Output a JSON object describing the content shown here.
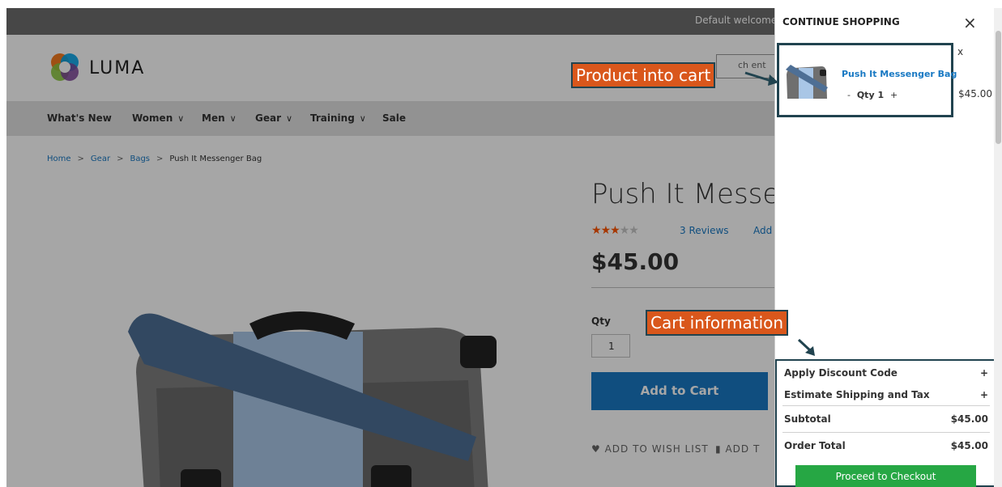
{
  "topbar": {
    "welcome": "Default welcome"
  },
  "header": {
    "logo_text": "LUMA",
    "search_placeholder": "ch ent"
  },
  "nav": [
    {
      "label": "What's New",
      "chevron": ""
    },
    {
      "label": "Women",
      "chevron": "∨"
    },
    {
      "label": "Men",
      "chevron": "∨"
    },
    {
      "label": "Gear",
      "chevron": "∨"
    },
    {
      "label": "Training",
      "chevron": "∨"
    },
    {
      "label": "Sale",
      "chevron": ""
    }
  ],
  "breadcrumb": {
    "home": "Home",
    "gear": "Gear",
    "bags": "Bags",
    "current": "Push It Messenger Bag",
    "sep": ">"
  },
  "product": {
    "title": "Push It Messe",
    "rating_out_of_5": 3,
    "reviews": "3 Reviews",
    "add_review": "Add",
    "price": "$45.00",
    "qty_label": "Qty",
    "qty_value": "1",
    "add_to_cart": "Add to Cart",
    "wishlist": "ADD TO WISH LIST",
    "compare": "ADD T"
  },
  "minicart": {
    "title": "CONTINUE SHOPPING",
    "close": "×",
    "item": {
      "name": "Push It Messenger Bag",
      "qty_minus": "-",
      "qty_text": "Qty 1",
      "qty_plus": "+",
      "remove": "x",
      "price": "$45.00"
    },
    "discount": {
      "label": "Apply Discount Code",
      "toggle": "+"
    },
    "shipping": {
      "label": "Estimate Shipping and Tax",
      "toggle": "+"
    },
    "subtotal": {
      "label": "Subtotal",
      "value": "$45.00"
    },
    "order_total": {
      "label": "Order Total",
      "value": "$45.00"
    },
    "checkout": "Proceed to Checkout"
  },
  "annotations": {
    "product_into_cart": "Product into cart",
    "cart_information": "Cart information"
  },
  "colors": {
    "accent_blue": "#1979c3",
    "annotation_orange": "#d9571c",
    "annotation_border": "#21434f",
    "checkout_green": "#26a744",
    "star": "#ff5501"
  }
}
